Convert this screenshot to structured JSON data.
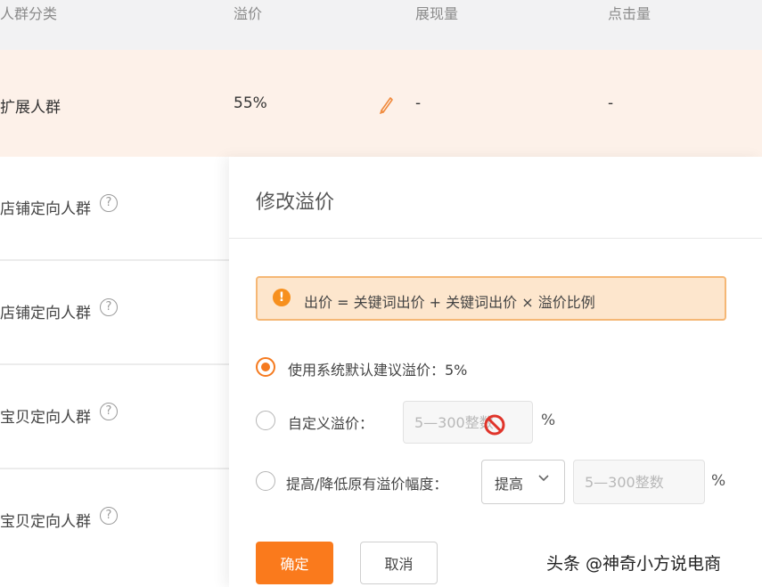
{
  "table": {
    "headers": [
      "人群分类",
      "溢价",
      "展现量",
      "点击量"
    ],
    "highlight_row": {
      "name": "扩展人群",
      "premium": "55%",
      "impressions": "-",
      "clicks": "-"
    },
    "rows": [
      {
        "name": "店铺定向人群"
      },
      {
        "name": "店铺定向人群"
      },
      {
        "name": "宝贝定向人群"
      },
      {
        "name": "宝贝定向人群"
      }
    ],
    "help_glyph": "?"
  },
  "modal": {
    "title": "修改溢价",
    "notice": {
      "icon": "!",
      "text": "出价 = 关键词出价 + 关键词出价 × 溢价比例"
    },
    "options": [
      {
        "label": "使用系统默认建议溢价：5%",
        "checked": true
      },
      {
        "label": "自定义溢价：",
        "checked": false,
        "input_placeholder": "5—300整数",
        "unit": "%"
      },
      {
        "label": "提高/降低原有溢价幅度：",
        "checked": false,
        "select_value": "提高",
        "input_placeholder": "5—300整数",
        "unit": "%"
      }
    ],
    "confirm_label": "确定",
    "cancel_label": "取消"
  },
  "watermark": "头条 @神奇小方说电商",
  "colors": {
    "accent": "#fa7a1c",
    "highlight_row_bg": "#fdf1e9",
    "notice_bg": "#fde6cd",
    "notice_border": "#f5b775"
  }
}
